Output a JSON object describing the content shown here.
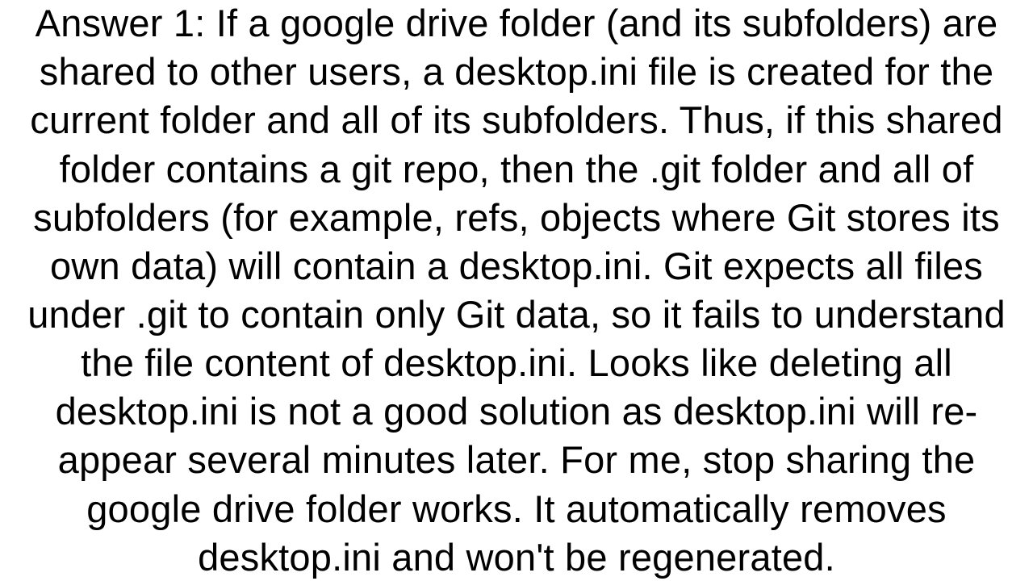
{
  "answer": {
    "label": "Answer 1:",
    "text": "Answer 1: If a google drive folder (and its subfolders) are shared to other users, a desktop.ini file is created for the current folder and all of its subfolders. Thus, if this shared folder contains a git repo, then the .git folder and all of subfolders (for example, refs, objects where Git stores its own data) will contain a desktop.ini. Git expects all files under .git to contain only Git data, so it fails to understand the file content of desktop.ini. Looks like deleting all desktop.ini is not a good solution as desktop.ini will re-appear several minutes later. For me, stop sharing the google drive folder works. It automatically removes desktop.ini and won't be regenerated."
  }
}
